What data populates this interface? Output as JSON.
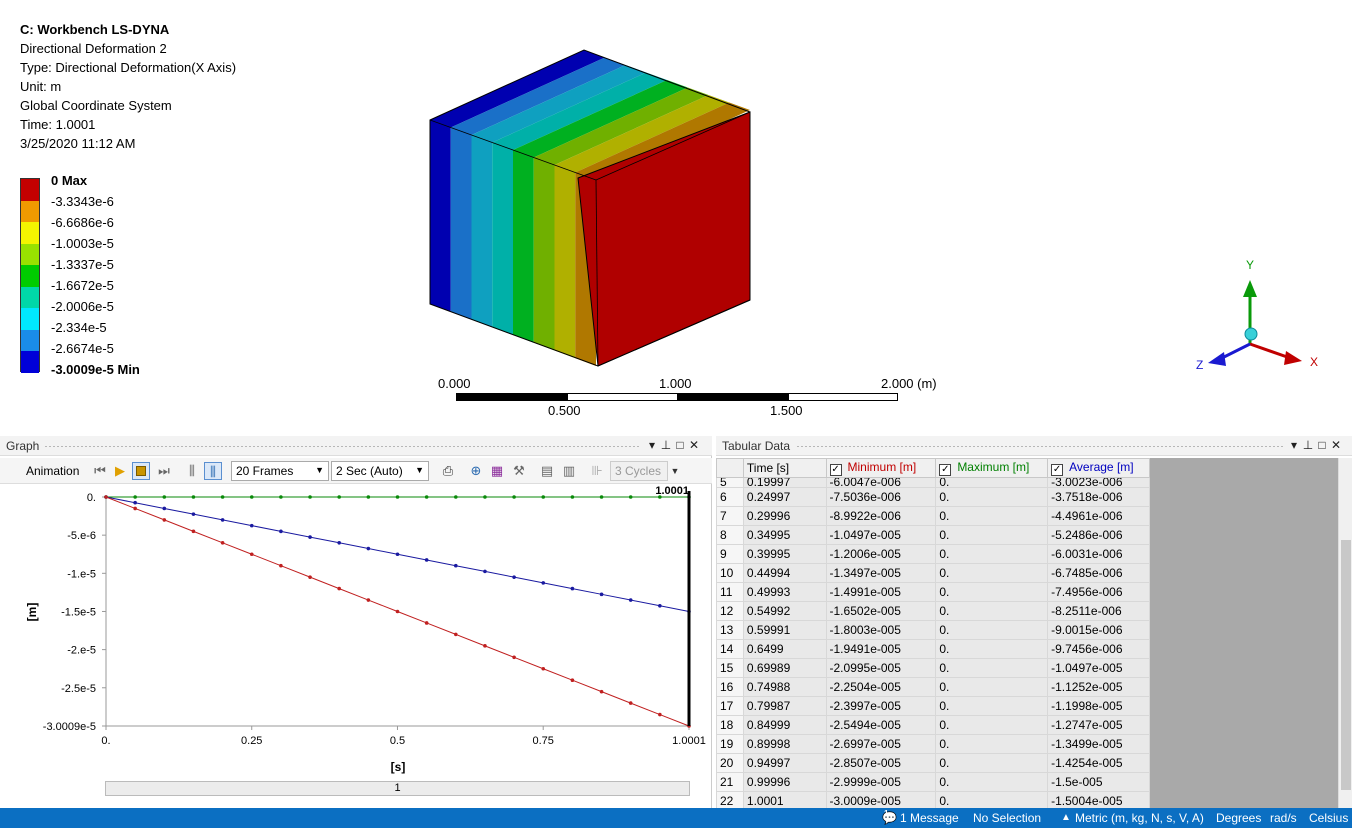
{
  "info": {
    "title": "C: Workbench LS-DYNA",
    "result_name": "Directional Deformation 2",
    "type": "Type: Directional Deformation(X Axis)",
    "unit": "Unit: m",
    "coord": "Global Coordinate System",
    "time": "Time: 1.0001",
    "date": "3/25/2020 11:12 AM"
  },
  "legend": {
    "colors": [
      "#c40000",
      "#f09a00",
      "#f4f400",
      "#99e100",
      "#00cc00",
      "#00d8a8",
      "#00e8ff",
      "#1a8ce8",
      "#0000d8"
    ],
    "labels": [
      "0 Max",
      "-3.3343e-6",
      "-6.6686e-6",
      "-1.0003e-5",
      "-1.3337e-5",
      "-1.6672e-5",
      "-2.0006e-5",
      "-2.334e-5",
      "-2.6674e-5",
      "-3.0009e-5 Min"
    ]
  },
  "scale": {
    "l0": "0.000",
    "l1": "1.000",
    "l2": "2.000 (m)",
    "l3": "0.500",
    "l4": "1.500"
  },
  "triad": {
    "x": "X",
    "y": "Y",
    "z": "Z"
  },
  "graph": {
    "title": "Graph",
    "animation_label": "Animation",
    "frames": "20 Frames",
    "duration": "2 Sec (Auto)",
    "cycles": "3 Cycles",
    "slider_label": "1"
  },
  "chart_data": {
    "type": "line",
    "title": "",
    "xlabel": "[s]",
    "ylabel": "[m]",
    "xlim": [
      0,
      1.0001
    ],
    "ylim": [
      -3.0009e-05,
      0
    ],
    "x_ticks": [
      "0.",
      "0.25",
      "0.5",
      "0.75",
      "1.0001"
    ],
    "y_ticks": [
      "0.",
      "-5.e-6",
      "-1.e-5",
      "-1.5e-5",
      "-2.e-5",
      "-2.5e-5",
      "-3.0009e-5"
    ],
    "marker_label": "1.0001",
    "series": [
      {
        "color": "#0a8a0a",
        "x_end": 1.0001,
        "y_end": 0
      },
      {
        "color": "#1a1aa0",
        "x_end": 1.0001,
        "y_end": -1.5004e-05
      },
      {
        "color": "#c02020",
        "x_end": 1.0001,
        "y_end": -3.0009e-05
      }
    ],
    "points_per_series": 21
  },
  "table": {
    "title": "Tabular Data",
    "headers": {
      "time": "Time [s]",
      "min": "Minimum [m]",
      "max": "Maximum [m]",
      "avg": "Average [m]"
    },
    "header_colors": {
      "min": "#c00000",
      "max": "#008000",
      "avg": "#0000c0"
    },
    "partial_row": [
      "5",
      "0.19997",
      "-6.0047e-006",
      "0.",
      "-3.0023e-006"
    ],
    "rows": [
      [
        "6",
        "0.24997",
        "-7.5036e-006",
        "0.",
        "-3.7518e-006"
      ],
      [
        "7",
        "0.29996",
        "-8.9922e-006",
        "0.",
        "-4.4961e-006"
      ],
      [
        "8",
        "0.34995",
        "-1.0497e-005",
        "0.",
        "-5.2486e-006"
      ],
      [
        "9",
        "0.39995",
        "-1.2006e-005",
        "0.",
        "-6.0031e-006"
      ],
      [
        "10",
        "0.44994",
        "-1.3497e-005",
        "0.",
        "-6.7485e-006"
      ],
      [
        "11",
        "0.49993",
        "-1.4991e-005",
        "0.",
        "-7.4956e-006"
      ],
      [
        "12",
        "0.54992",
        "-1.6502e-005",
        "0.",
        "-8.2511e-006"
      ],
      [
        "13",
        "0.59991",
        "-1.8003e-005",
        "0.",
        "-9.0015e-006"
      ],
      [
        "14",
        "0.6499",
        "-1.9491e-005",
        "0.",
        "-9.7456e-006"
      ],
      [
        "15",
        "0.69989",
        "-2.0995e-005",
        "0.",
        "-1.0497e-005"
      ],
      [
        "16",
        "0.74988",
        "-2.2504e-005",
        "0.",
        "-1.1252e-005"
      ],
      [
        "17",
        "0.79987",
        "-2.3997e-005",
        "0.",
        "-1.1998e-005"
      ],
      [
        "18",
        "0.84999",
        "-2.5494e-005",
        "0.",
        "-1.2747e-005"
      ],
      [
        "19",
        "0.89998",
        "-2.6997e-005",
        "0.",
        "-1.3499e-005"
      ],
      [
        "20",
        "0.94997",
        "-2.8507e-005",
        "0.",
        "-1.4254e-005"
      ],
      [
        "21",
        "0.99996",
        "-2.9999e-005",
        "0.",
        "-1.5e-005"
      ],
      [
        "22",
        "1.0001",
        "-3.0009e-005",
        "0.",
        "-1.5004e-005"
      ]
    ]
  },
  "statusbar": {
    "messages_count": "1",
    "messages": "1 Message",
    "selection": "No Selection",
    "units": "Metric (m, kg, N, s, V, A)",
    "angle": "Degrees",
    "rot": "rad/s",
    "temp": "Celsius"
  }
}
